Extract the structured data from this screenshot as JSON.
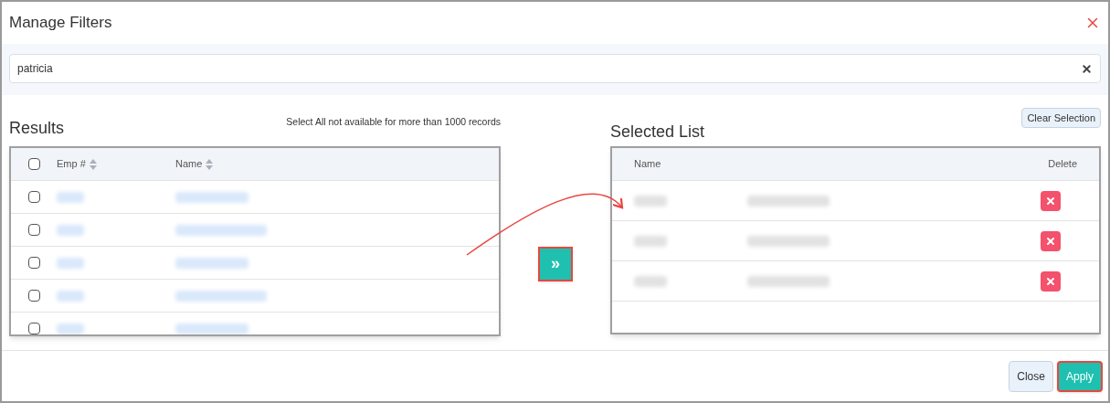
{
  "dialog": {
    "title": "Manage Filters"
  },
  "search": {
    "value": "patricia"
  },
  "results": {
    "title": "Results",
    "note": "Select All not available for more than 1000 records",
    "select_all_checked": false,
    "columns": [
      "Emp #",
      "Name"
    ],
    "rows": [
      {
        "checked": false
      },
      {
        "checked": false
      },
      {
        "checked": false
      },
      {
        "checked": false
      },
      {
        "checked": false
      }
    ]
  },
  "move_button": "»",
  "selected_list": {
    "title": "Selected List",
    "clear_button": "Clear Selection",
    "columns": [
      "Name",
      "Delete"
    ],
    "rows": [
      {},
      {},
      {}
    ]
  },
  "footer": {
    "buttons": [
      {
        "label": "Close",
        "kind": "secondary"
      },
      {
        "label": "Apply",
        "kind": "primary"
      }
    ]
  }
}
